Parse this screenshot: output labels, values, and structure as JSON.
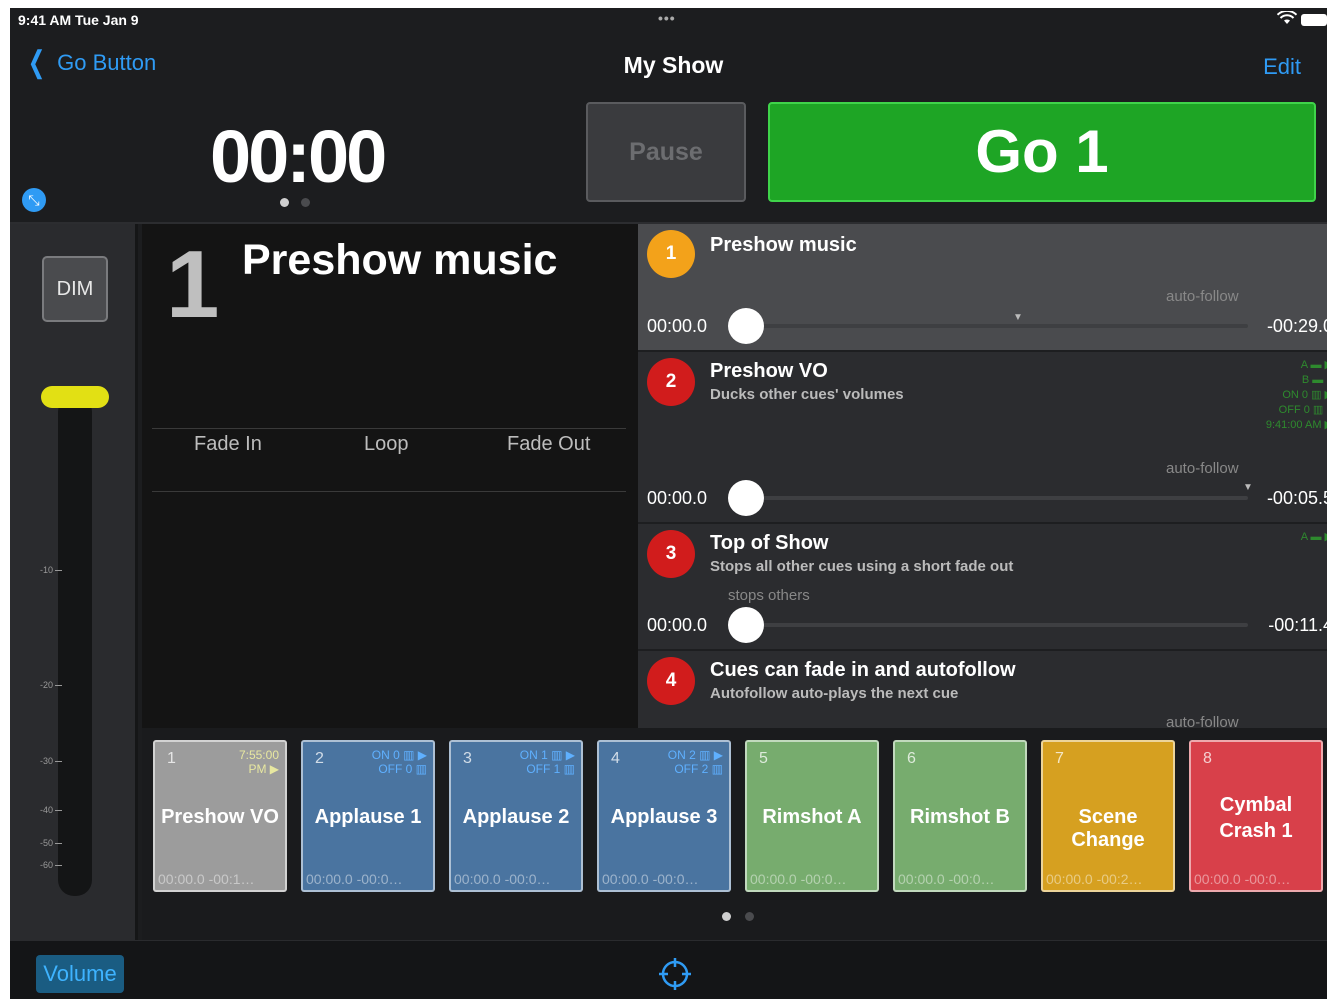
{
  "status": {
    "time": "9:41 AM   Tue Jan 9",
    "dots": "•••"
  },
  "nav": {
    "back_label": "Go Button",
    "title": "My Show",
    "edit_label": "Edit"
  },
  "transport": {
    "timer": "00:00",
    "pause_label": "Pause",
    "go_label": "Go 1"
  },
  "volume": {
    "dim_label": "DIM",
    "ticks": [
      "-10",
      "-20",
      "-30",
      "-40",
      "-50",
      "-60"
    ]
  },
  "current_cue": {
    "number": "1",
    "name": "Preshow music",
    "fade_in": "Fade In",
    "loop": "Loop",
    "fade_out": "Fade Out"
  },
  "cue_list": [
    {
      "number": "1",
      "title": "Preshow music",
      "subtitle": "",
      "note": "auto-follow",
      "time_start": "00:00.0",
      "time_end": "-00:29.0",
      "color": "#f3a21a"
    },
    {
      "number": "2",
      "title": "Preshow VO",
      "subtitle": "Ducks other cues' volumes",
      "note": "auto-follow",
      "time_start": "00:00.0",
      "time_end": "-00:05.5",
      "color": "#d11c1c",
      "triggers": [
        "A ▬ ▶",
        "B ▬ ■",
        "ON 0 ▥ ▶",
        "OFF 0 ▥ ■",
        "9:41:00 AM ▶"
      ]
    },
    {
      "number": "3",
      "title": "Top of Show",
      "subtitle": "Stops all other cues using a short fade out",
      "note": "stops others",
      "time_start": "00:00.0",
      "time_end": "-00:11.4",
      "color": "#d11c1c",
      "triggers": [
        "A ▬ ▶"
      ]
    },
    {
      "number": "4",
      "title": "Cues can fade in and autofollow",
      "subtitle": "Autofollow auto-plays the next cue",
      "note": "auto-follow",
      "color": "#d11c1c"
    }
  ],
  "tiles": [
    {
      "number": "1",
      "label": "Preshow VO",
      "footer": "00:00.0  -00:1…",
      "info": [
        "7:55:00",
        "PM ▶"
      ],
      "color": "#9c9c9c"
    },
    {
      "number": "2",
      "label": "Applause 1",
      "footer": "00:00.0  -00:0…",
      "info": [
        "ON 0 ▥ ▶",
        "OFF 0 ▥"
      ],
      "color": "#4a74a0"
    },
    {
      "number": "3",
      "label": "Applause 2",
      "footer": "00:00.0  -00:0…",
      "info": [
        "ON 1 ▥ ▶",
        "OFF 1 ▥"
      ],
      "color": "#4a74a0"
    },
    {
      "number": "4",
      "label": "Applause 3",
      "footer": "00:00.0  -00:0…",
      "info": [
        "ON 2 ▥ ▶",
        "OFF 2 ▥"
      ],
      "color": "#4a74a0"
    },
    {
      "number": "5",
      "label": "Rimshot A",
      "footer": "00:00.0  -00:0…",
      "info": [],
      "color": "#77ac6e"
    },
    {
      "number": "6",
      "label": "Rimshot B",
      "footer": "00:00.0  -00:0…",
      "info": [],
      "color": "#77ac6e"
    },
    {
      "number": "7",
      "label": "Scene Change",
      "footer": "00:00.0  -00:2…",
      "info": [],
      "color": "#d6a020"
    },
    {
      "number": "8",
      "label": "Cymbal Crash 1",
      "footer": "00:00.0  -00:0…",
      "info": [],
      "color": "#d8404a"
    }
  ],
  "bottom": {
    "volume_label": "Volume"
  },
  "colors": {
    "accent": "#2f9bf4",
    "go_green": "#1ea525",
    "slider_knob": "#e2e014"
  }
}
